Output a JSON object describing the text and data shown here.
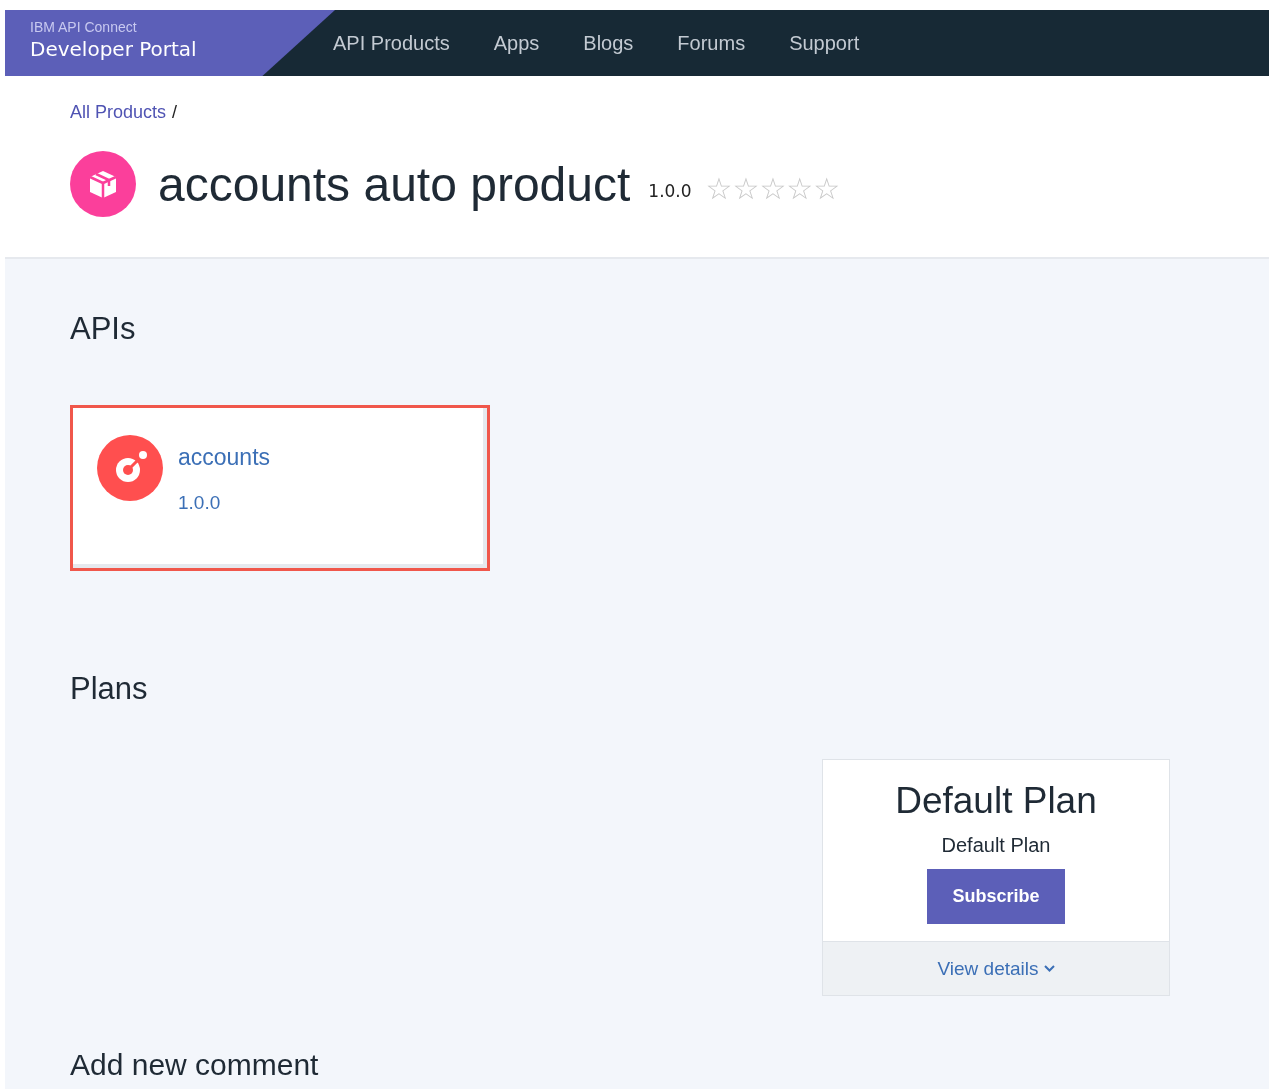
{
  "header": {
    "brand_top": "IBM API Connect",
    "brand_bottom": "Developer Portal",
    "nav": [
      {
        "label": "API Products"
      },
      {
        "label": "Apps"
      },
      {
        "label": "Blogs"
      },
      {
        "label": "Forums"
      },
      {
        "label": "Support"
      }
    ]
  },
  "breadcrumb": {
    "link": "All Products",
    "separator": "/"
  },
  "product": {
    "title": "accounts auto product",
    "version": "1.0.0",
    "stars": 0
  },
  "apis": {
    "heading": "APIs",
    "items": [
      {
        "name": "accounts",
        "version": "1.0.0",
        "highlighted": true
      }
    ]
  },
  "plans": {
    "heading": "Plans",
    "items": [
      {
        "title": "Default Plan",
        "description": "Default Plan",
        "button": "Subscribe",
        "details": "View details"
      }
    ]
  },
  "comments": {
    "heading": "Add new comment"
  }
}
